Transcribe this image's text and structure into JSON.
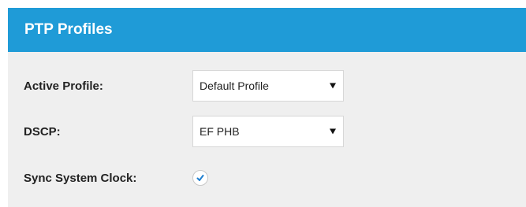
{
  "panel": {
    "title": "PTP Profiles",
    "header_color": "#1f9bd7"
  },
  "fields": {
    "active_profile": {
      "label": "Active Profile:",
      "value": "Default Profile"
    },
    "dscp": {
      "label": "DSCP:",
      "value": "EF PHB"
    },
    "sync_system_clock": {
      "label": "Sync System Clock:",
      "checked": true,
      "icon": "check-icon"
    }
  }
}
